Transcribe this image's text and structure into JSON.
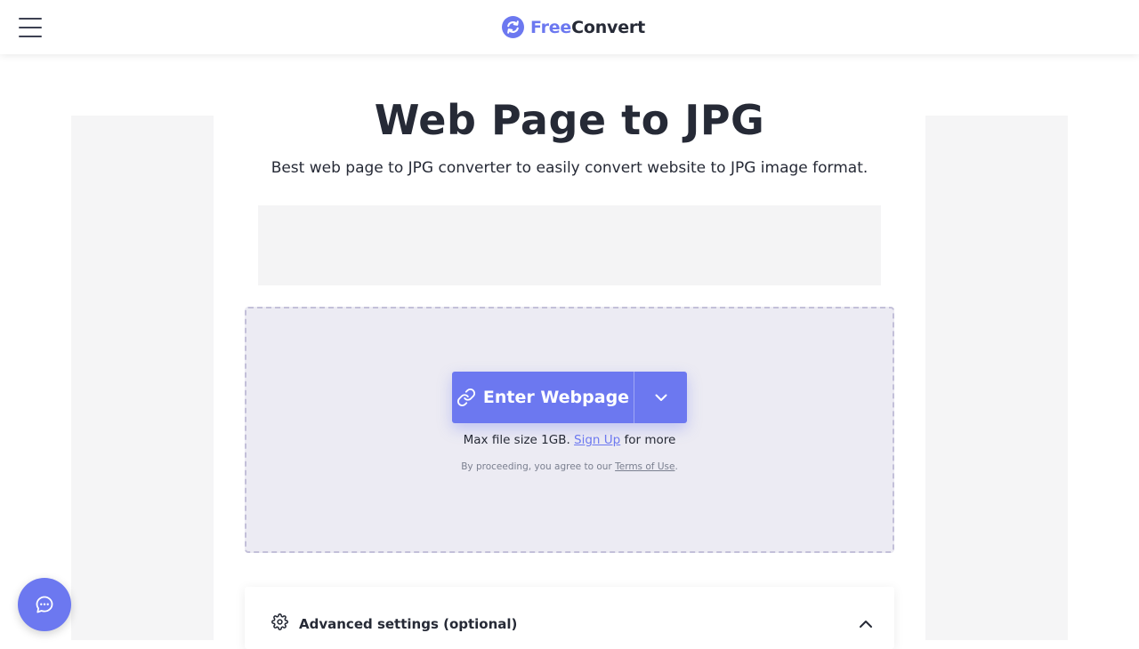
{
  "brand": {
    "name_part1": "Free",
    "name_part2": "Convert",
    "accent": "#6c78f0",
    "text": "#262a36"
  },
  "header": {
    "menu_icon": "hamburger-menu-icon",
    "logo_icon": "refresh-arrows-icon"
  },
  "main": {
    "title": "Web Page to JPG",
    "subtitle": "Best web page to JPG converter to easily convert website to JPG image format."
  },
  "upload": {
    "button_label": "Enter Webpage",
    "button_icon": "link-icon",
    "dropdown_icon": "chevron-down-icon",
    "max_size_text": "Max file size 1GB.",
    "signup_link": "Sign Up",
    "max_size_suffix": "for more",
    "terms_prefix": "By proceeding, you agree to our",
    "terms_link": "Terms of Use",
    "terms_suffix": "."
  },
  "advanced": {
    "label": "Advanced settings (optional)",
    "icon": "gear-icon",
    "toggle_icon": "chevron-up-icon"
  },
  "chat": {
    "icon": "chat-bubble-icon"
  }
}
